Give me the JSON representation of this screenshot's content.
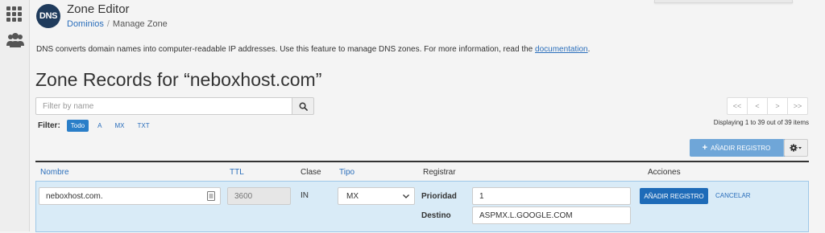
{
  "app": {
    "title": "Zone Editor",
    "logo_text": "DNS",
    "breadcrumb": {
      "parent": "Dominios",
      "current": "Manage Zone"
    }
  },
  "sidebar": {
    "items": [
      "grid-icon",
      "users-icon"
    ]
  },
  "intro": {
    "text": "DNS converts domain names into computer-readable IP addresses. Use this feature to manage DNS zones. For more information, read the",
    "link": "documentation",
    "suffix": "."
  },
  "heading": "Zone Records for “neboxhost.com”",
  "search": {
    "placeholder": "Filter by name",
    "value": ""
  },
  "filter": {
    "label": "Filter:",
    "options": [
      "Todo",
      "A",
      "MX",
      "TXT"
    ],
    "active": "Todo"
  },
  "pagination": {
    "first": "<<",
    "prev": "<",
    "next": ">",
    "last": ">>",
    "summary": "Displaying 1 to 39 out of 39 items"
  },
  "toolbar": {
    "add_label": "AÑADIR REGISTRO"
  },
  "table": {
    "columns": {
      "name": "Nombre",
      "ttl": "TTL",
      "class": "Clase",
      "type": "Tipo",
      "record": "Registrar",
      "actions": "Acciones"
    },
    "edit_row": {
      "name": "neboxhost.com.",
      "ttl": "3600",
      "class": "IN",
      "type": "MX",
      "priority_label": "Prioridad",
      "priority": "1",
      "destination_label": "Destino",
      "destination": "ASPMX.L.GOOGLE.COM",
      "save_label": "AÑADIR REGISTRO",
      "cancel_label": "CANCELAR"
    }
  },
  "colors": {
    "accent": "#2a6ebb",
    "primary_button": "#1e6bb8",
    "edit_row_bg": "#d9ebf7"
  }
}
